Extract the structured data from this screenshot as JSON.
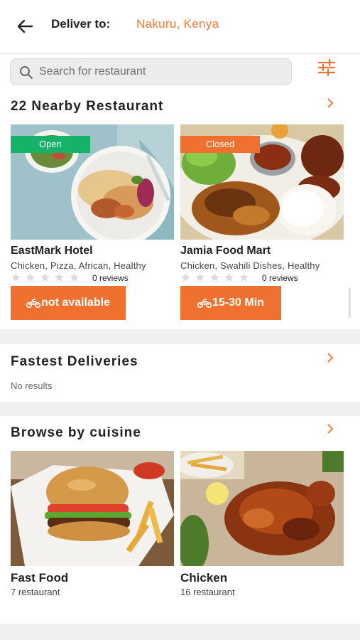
{
  "header": {
    "deliver_label": "Deliver to:",
    "location": "Nakuru, Kenya"
  },
  "search": {
    "placeholder": "Search for restaurant"
  },
  "nearby": {
    "title": "22 Nearby Restaurant",
    "restaurants": [
      {
        "status": "Open",
        "name": "EastMark Hotel",
        "tags": "Chicken, Pizza, African, Healthy",
        "reviews": "0 reviews",
        "eta": "not available"
      },
      {
        "status": "Closed",
        "name": "Jamia Food Mart",
        "tags": "Chicken, Swahili Dishes, Healthy",
        "reviews": "0 reviews",
        "eta": "15-30 Min"
      }
    ]
  },
  "fastest": {
    "title": "Fastest Deliveries",
    "empty_text": "No results"
  },
  "cuisine": {
    "title": "Browse by cuisine",
    "items": [
      {
        "name": "Fast Food",
        "count": "7 restaurant"
      },
      {
        "name": "Chicken",
        "count": "16 restaurant"
      }
    ]
  },
  "colors": {
    "accent": "#f07030",
    "open": "#17b26a",
    "location": "#f07b3a"
  },
  "icons": [
    "back-arrow-icon",
    "search-icon",
    "filter-icon",
    "chevron-right-icon",
    "star-icon",
    "motorbike-icon"
  ]
}
